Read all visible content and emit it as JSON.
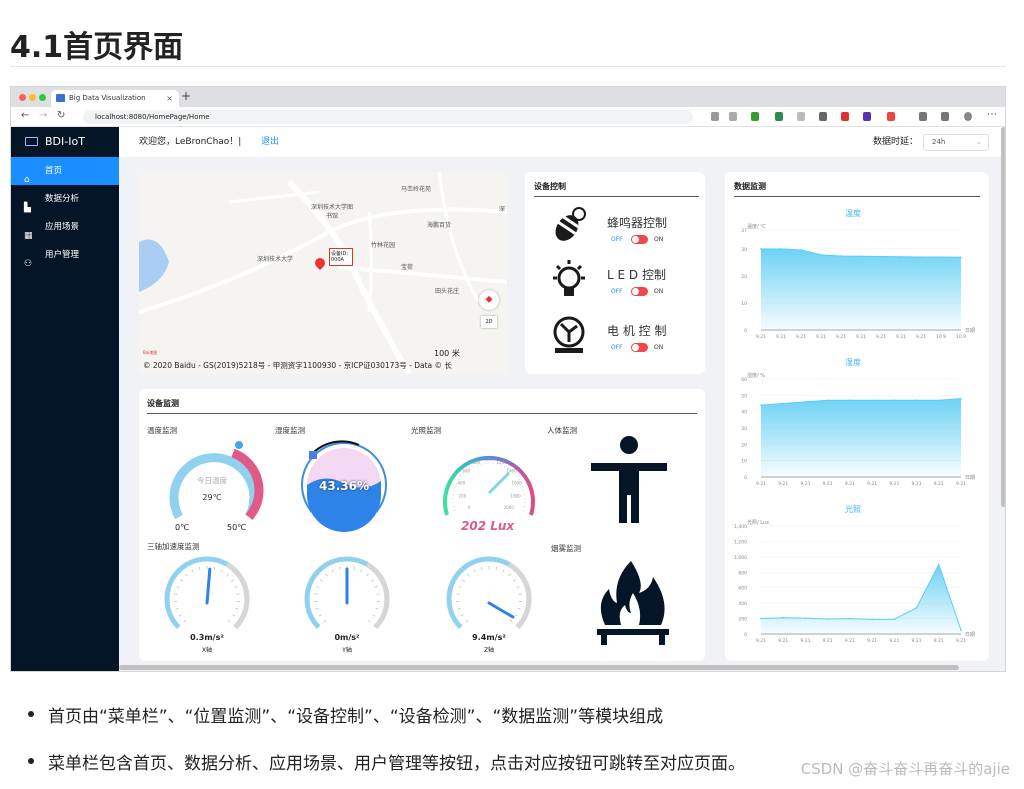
{
  "heading": "4.1首页界面",
  "browser": {
    "tab_title": "Big Data Visualization",
    "url": "localhost:8080/HomePage/Home",
    "tab_close": "×",
    "new_tab": "+"
  },
  "sidebar": {
    "logo": "BDI-IoT",
    "items": [
      {
        "label": "首页",
        "icon": "⌂",
        "active": true
      },
      {
        "label": "数据分析",
        "icon": "▙"
      },
      {
        "label": "应用场景",
        "icon": "▦"
      },
      {
        "label": "用户管理",
        "icon": "⚇"
      }
    ]
  },
  "topbar": {
    "welcome": "欢迎您，LeBronChao！|",
    "logout": "退出",
    "delay_label": "数据时延：",
    "delay_value": "24h"
  },
  "map": {
    "labels": [
      "马峦岭花苑",
      "深圳技术大学图书馆",
      "海鹏百货",
      "竹林花园",
      "深圳技术大学",
      "设备ID: 000A",
      "宝荷",
      "田头花庄",
      "深"
    ],
    "scale": "100 米",
    "copyright": "© 2020 Baidu - GS(2019)5218号 - 甲测资字1100930 - 京ICP证030173号 - Data © 长",
    "button_2d": "2D",
    "brand": "Bai地图"
  },
  "device_control": {
    "title": "设备控制",
    "items": [
      {
        "label": "蜂鸣器控制",
        "icon": "bee-icon"
      },
      {
        "label": "L E D 控制",
        "icon": "bulb-icon"
      },
      {
        "label": "电 机 控 制",
        "icon": "motor-icon"
      }
    ],
    "off": "OFF",
    "on": "ON"
  },
  "device_monitor": {
    "title": "设备监测",
    "temp": {
      "label": "温度监测",
      "center": "今日温度",
      "value": "29℃",
      "min": "0℃",
      "max": "50℃"
    },
    "humidity": {
      "label": "湿度监测",
      "value": "43.36%"
    },
    "light": {
      "label": "光照监测",
      "value": "202 Lux",
      "ticks": [
        "0",
        "200",
        "400",
        "600",
        "800",
        "1000",
        "1200",
        "1400",
        "1600",
        "1800",
        "2000"
      ]
    },
    "human": {
      "label": "人体监测"
    },
    "accel": {
      "label": "三轴加速度监测",
      "items": [
        {
          "value": "0.3m/s²",
          "axis": "X轴",
          "level": 0.02
        },
        {
          "value": "0m/s²",
          "axis": "Y轴",
          "level": 0
        },
        {
          "value": "9.4m/s²",
          "axis": "Z轴",
          "level": 0.47
        }
      ]
    },
    "smoke": {
      "label": "烟雾监测"
    }
  },
  "data_monitor": {
    "title": "数据监测",
    "charts": [
      {
        "type": "area",
        "title": "温度",
        "ylabel": "温度/ ℃",
        "xlabel": "日期",
        "yticks": [
          "0",
          "10",
          "20",
          "30",
          "37"
        ],
        "ylim": [
          0,
          37
        ],
        "x": [
          "9.21",
          "9.21",
          "9.21",
          "9.21",
          "9.21",
          "9.21",
          "9.21",
          "9.21",
          "9.21",
          "10.9",
          "10.9"
        ],
        "values": [
          30,
          30,
          29.6,
          27.8,
          27.4,
          27.3,
          27.2,
          27.1,
          27,
          27,
          26.9
        ]
      },
      {
        "type": "area",
        "title": "湿度",
        "ylabel": "湿度/ %",
        "xlabel": "日期",
        "yticks": [
          "0",
          "10",
          "20",
          "30",
          "40",
          "50",
          "60"
        ],
        "ylim": [
          0,
          60
        ],
        "x": [
          "9.21",
          "9.21",
          "9.21",
          "9.21",
          "9.21",
          "9.21",
          "9.21",
          "9.21",
          "9.21",
          "9.21"
        ],
        "values": [
          44,
          45,
          46,
          47,
          47,
          47,
          47,
          47,
          47,
          48
        ]
      },
      {
        "type": "area",
        "title": "光照",
        "ylabel": "光照/ Lux",
        "xlabel": "日期",
        "yticks": [
          "0",
          "200",
          "400",
          "600",
          "800",
          "1,000",
          "1,200",
          "1,400"
        ],
        "ylim": [
          0,
          1400
        ],
        "x": [
          "9.21",
          "9.21",
          "9.21",
          "9.21",
          "9.21",
          "9.21",
          "9.21",
          "9.21",
          "9.21",
          "9.21"
        ],
        "values": [
          200,
          210,
          205,
          195,
          200,
          190,
          190,
          340,
          900,
          50
        ]
      }
    ]
  },
  "bullets": [
    "首页由“菜单栏”、“位置监测”、“设备控制”、“设备检测”、“数据监测”等模块组成",
    "菜单栏包含首页、数据分析、应用场景、用户管理等按钮，点击对应按钮可跳转至对应页面。"
  ],
  "watermark": "CSDN @奋斗奋斗再奋斗的ajie",
  "colors": {
    "accent": "#1b8fff",
    "sidebar": "#041527",
    "chart": "#5ccdf4"
  }
}
